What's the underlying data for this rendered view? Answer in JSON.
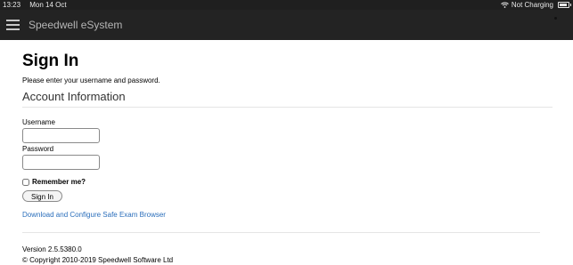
{
  "status_bar": {
    "time": "13:23",
    "date": "Mon 14 Oct",
    "charging": "Not Charging"
  },
  "navbar": {
    "brand": "Speedwell eSystem"
  },
  "page": {
    "title": "Sign In",
    "intro": "Please enter your username and password.",
    "section_title": "Account Information"
  },
  "form": {
    "username_label": "Username",
    "username_value": "",
    "password_label": "Password",
    "password_value": "",
    "remember_label": "Remember me?",
    "remember_checked": false,
    "signin_label": "Sign In"
  },
  "links": {
    "seb": "Download and Configure Safe Exam Browser"
  },
  "footer": {
    "version": "Version 2.5.5380.0",
    "copyright": "© Copyright 2010-2019 Speedwell Software Ltd"
  }
}
